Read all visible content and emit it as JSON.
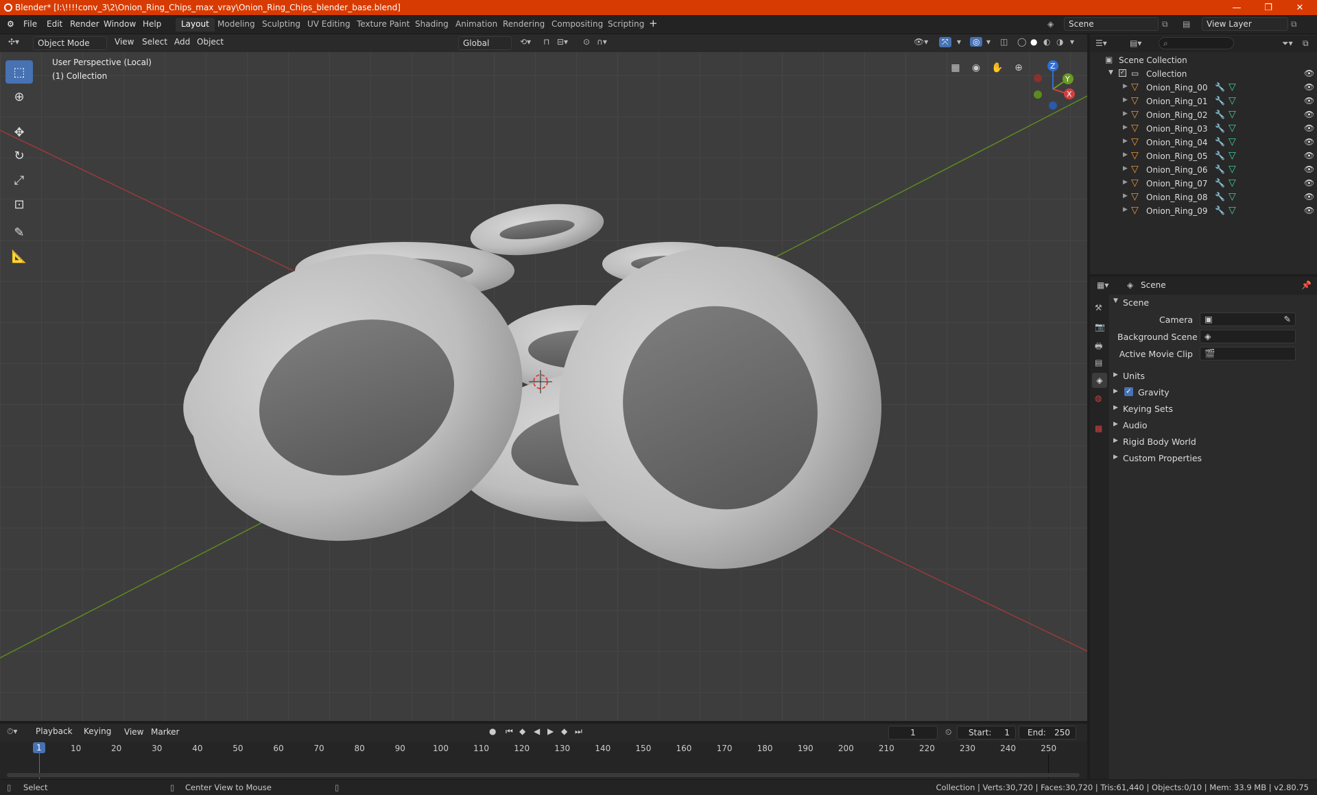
{
  "window": {
    "title": "Blender* [I:\\!!!!conv_3\\2\\Onion_Ring_Chips_max_vray\\Onion_Ring_Chips_blender_base.blend]",
    "minimize": "—",
    "maximize": "❐",
    "close": "✕"
  },
  "menus": [
    "File",
    "Edit",
    "Render",
    "Window",
    "Help"
  ],
  "workspaces": [
    "Layout",
    "Modeling",
    "Sculpting",
    "UV Editing",
    "Texture Paint",
    "Shading",
    "Animation",
    "Rendering",
    "Compositing",
    "Scripting"
  ],
  "scene_selector": "Scene",
  "view_layer": "View Layer",
  "viewport_header": {
    "mode": "Object Mode",
    "menus": [
      "View",
      "Select",
      "Add",
      "Object"
    ],
    "orientation": "Global"
  },
  "viewport_info": {
    "perspective": "User Perspective (Local)",
    "collection": "(1) Collection"
  },
  "gizmo": {
    "z": "Z",
    "y": "Y",
    "x": "X"
  },
  "colors": {
    "accent": "#4772b3",
    "titlebar": "#d83b01",
    "x_axis": "#b43c3c",
    "y_axis": "#6b9623",
    "mesh": "#bfbfbf"
  },
  "outliner": {
    "root": "Scene Collection",
    "collection": "Collection",
    "objects": [
      "Onion_Ring_00",
      "Onion_Ring_01",
      "Onion_Ring_02",
      "Onion_Ring_03",
      "Onion_Ring_04",
      "Onion_Ring_05",
      "Onion_Ring_06",
      "Onion_Ring_07",
      "Onion_Ring_08",
      "Onion_Ring_09"
    ]
  },
  "properties": {
    "header": "Scene",
    "panel": "Scene",
    "fields": [
      "Camera",
      "Background Scene",
      "Active Movie Clip"
    ],
    "sections": [
      "Units",
      "Gravity",
      "Keying Sets",
      "Audio",
      "Rigid Body World",
      "Custom Properties"
    ]
  },
  "timeline": {
    "menus": [
      "Playback",
      "Keying",
      "View",
      "Marker"
    ],
    "current_frame": "1",
    "start_label": "Start:",
    "start": "1",
    "end_label": "End:",
    "end": "250",
    "ticks": [
      "1",
      "10",
      "20",
      "30",
      "40",
      "50",
      "60",
      "70",
      "80",
      "90",
      "100",
      "110",
      "120",
      "130",
      "140",
      "150",
      "160",
      "170",
      "180",
      "190",
      "200",
      "210",
      "220",
      "230",
      "240",
      "250"
    ]
  },
  "statusbar": {
    "select": "Select",
    "center": "Center View to Mouse",
    "stats": "Collection | Verts:30,720 | Faces:30,720 | Tris:61,440 | Objects:0/10 | Mem: 33.9 MB | v2.80.75"
  }
}
